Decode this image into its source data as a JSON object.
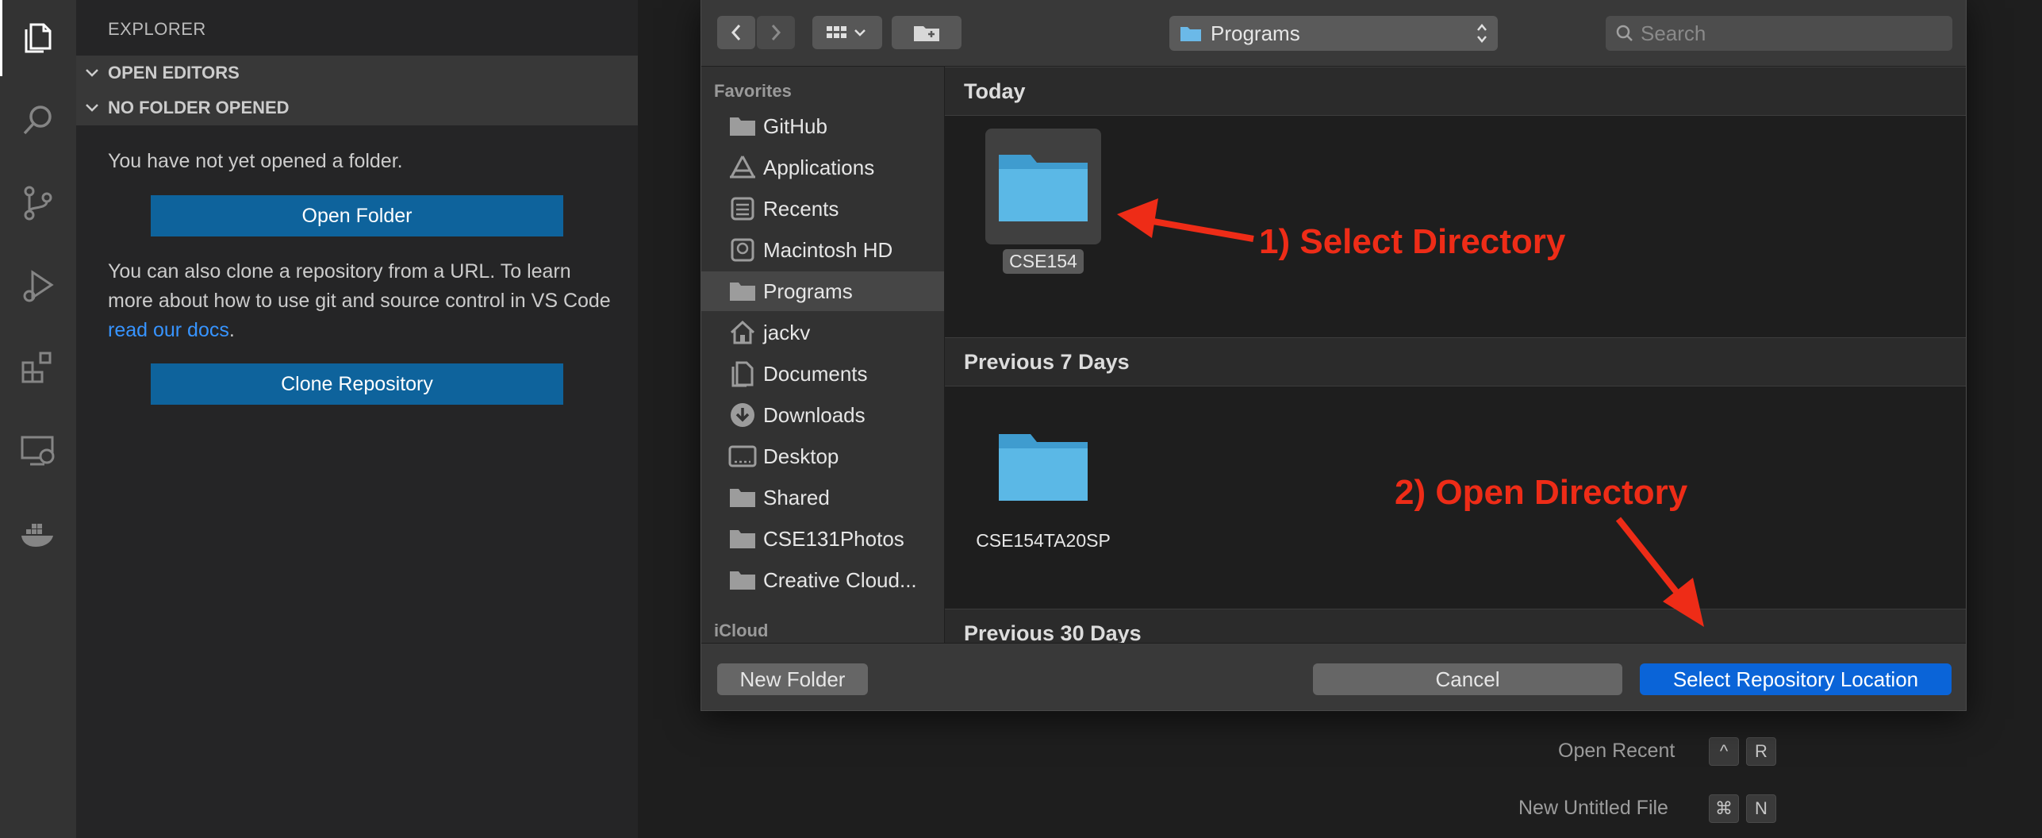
{
  "sidebar": {
    "title": "EXPLORER",
    "sections": [
      "OPEN EDITORS",
      "NO FOLDER OPENED"
    ],
    "no_folder_text": "You have not yet opened a folder.",
    "open_folder_label": "Open Folder",
    "clone_text_1": "You can also clone a repository from a URL. To learn more about how to use git and source control in VS Code ",
    "clone_link": "read our docs",
    "clone_text_2": ".",
    "clone_repository_label": "Clone Repository"
  },
  "activity_bar": {
    "icons": [
      "files-icon",
      "search-icon",
      "source-control-icon",
      "run-debug-icon",
      "extensions-icon",
      "remote-explorer-icon",
      "docker-icon"
    ]
  },
  "editor_hints": [
    {
      "label": "Open Recent",
      "keys": [
        "^",
        "R"
      ]
    },
    {
      "label": "New Untitled File",
      "keys": [
        "⌘",
        "N"
      ]
    }
  ],
  "dialog": {
    "location": "Programs",
    "search_placeholder": "Search",
    "favorites_header": "Favorites",
    "favorites": [
      {
        "label": "GitHub",
        "icon": "folder-icon"
      },
      {
        "label": "Applications",
        "icon": "applications-icon"
      },
      {
        "label": "Recents",
        "icon": "recents-icon"
      },
      {
        "label": "Macintosh HD",
        "icon": "disk-icon"
      },
      {
        "label": "Programs",
        "icon": "folder-icon",
        "selected": true
      },
      {
        "label": "jackv",
        "icon": "home-icon"
      },
      {
        "label": "Documents",
        "icon": "documents-icon"
      },
      {
        "label": "Downloads",
        "icon": "downloads-icon"
      },
      {
        "label": "Desktop",
        "icon": "desktop-icon"
      },
      {
        "label": "Shared",
        "icon": "folder-icon"
      },
      {
        "label": "CSE131Photos",
        "icon": "folder-icon"
      },
      {
        "label": "Creative Cloud...",
        "icon": "folder-icon"
      }
    ],
    "icloud_header": "iCloud",
    "groups": [
      {
        "title": "Today",
        "items": [
          {
            "name": "CSE154",
            "selected": true
          }
        ]
      },
      {
        "title": "Previous 7 Days",
        "items": [
          {
            "name": "CSE154TA20SP",
            "selected": false
          }
        ]
      },
      {
        "title": "Previous 30 Days",
        "items": []
      }
    ],
    "new_folder_label": "New Folder",
    "cancel_label": "Cancel",
    "confirm_label": "Select Repository Location"
  },
  "annotations": {
    "step1": "1) Select Directory",
    "step2": "2) Open Directory"
  },
  "colors": {
    "accent": "#0e639c",
    "dialog_primary": "#0a64d8",
    "annotation": "#ee2c17",
    "folder": "#5bb8e6",
    "link": "#3794ff"
  }
}
